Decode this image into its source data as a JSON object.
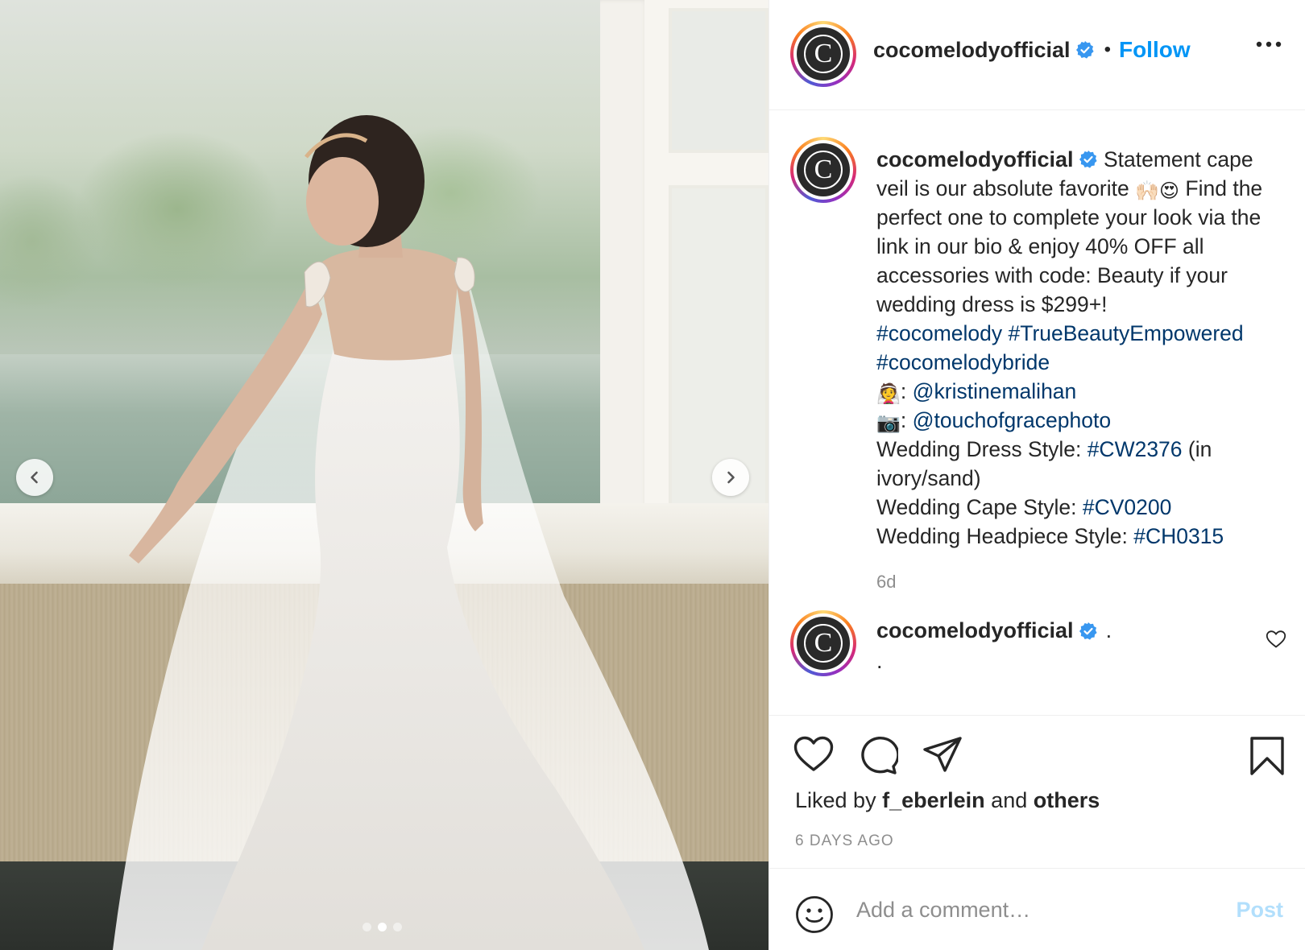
{
  "post": {
    "username": "cocomelodyofficial",
    "avatar_letter": "C",
    "follow_label": "Follow",
    "separator": "•"
  },
  "caption": {
    "username": "cocomelodyofficial",
    "text_1": "Statement cape veil is our absolute favorite",
    "emoji_1": "🙌🏻",
    "emoji_2": "😍",
    "text_2": "Find the perfect one to complete your look via the link in our bio & enjoy 40% OFF all accessories with code: Beauty if your wedding dress is $299+!",
    "tag_1": "#cocomelody",
    "tag_2": "#TrueBeautyEmpowered",
    "tag_3": "#cocomelodybride",
    "emoji_bride": "👰",
    "colon": ":",
    "mention_1": "@kristinemalihan",
    "emoji_camera": "📷",
    "mention_2": "@touchofgracephoto",
    "dress_label": "Wedding Dress Style:",
    "dress_tag": "#CW2376",
    "dress_note": "(in ivory/sand)",
    "cape_label": "Wedding Cape Style:",
    "cape_tag": "#CV0200",
    "headpiece_label": "Wedding Headpiece Style:",
    "headpiece_tag": "#CH0315",
    "age": "6d"
  },
  "comment": {
    "username": "cocomelodyofficial",
    "text": ".",
    "line2": "."
  },
  "likes": {
    "prefix": "Liked by",
    "user": "f_eberlein",
    "middle": "and",
    "others": "others"
  },
  "timestamp": "6 DAYS AGO",
  "add_comment": {
    "placeholder": "Add a comment…",
    "post_label": "Post"
  },
  "carousel": {
    "slide_count": 3,
    "active_slide": 2
  },
  "colors": {
    "link_blue": "#0095f6",
    "hashtag": "#00376b",
    "muted": "#8e8e8e",
    "post_disabled": "#b2dffc"
  },
  "icons": [
    "chevron-left-icon",
    "chevron-right-icon",
    "verified-badge-icon",
    "more-icon",
    "heart-icon",
    "comment-icon",
    "share-icon",
    "bookmark-icon",
    "smile-icon"
  ]
}
